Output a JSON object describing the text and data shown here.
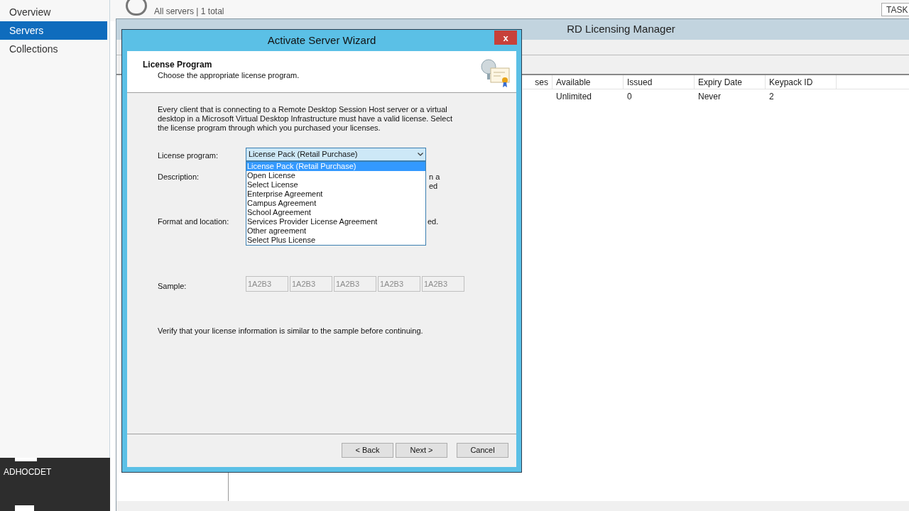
{
  "sidebar": {
    "items": [
      {
        "label": "Overview",
        "selected": false
      },
      {
        "label": "Servers",
        "selected": true
      },
      {
        "label": "Collections",
        "selected": false
      }
    ]
  },
  "taskbar": {
    "label": "ADHOCDET"
  },
  "header": {
    "subtitle": "All servers | 1 total",
    "tasks_button": "TASK"
  },
  "licensing_manager": {
    "title": "RD Licensing Manager",
    "columns": [
      "ses",
      "Available",
      "Issued",
      "Expiry Date",
      "Keypack ID"
    ],
    "rows": [
      [
        "",
        "Unlimited",
        "0",
        "Never",
        "2"
      ]
    ]
  },
  "wizard": {
    "title": "Activate Server Wizard",
    "close": "x",
    "heading": "License Program",
    "subheading": "Choose the appropriate license program.",
    "intro": "Every client that is connecting to a Remote Desktop Session Host server or a virtual desktop in a Microsoft Virtual Desktop Infrastructure must have a valid license. Select the license program through which you purchased your licenses.",
    "license_program": {
      "label": "License program:",
      "value": "License Pack (Retail Purchase)",
      "expanded": true,
      "options": [
        {
          "label": "License Pack (Retail Purchase)",
          "selected": true
        },
        {
          "label": "Open License",
          "selected": false
        },
        {
          "label": "Select License",
          "selected": false
        },
        {
          "label": "Enterprise Agreement",
          "selected": false
        },
        {
          "label": "Campus Agreement",
          "selected": false
        },
        {
          "label": "School Agreement",
          "selected": false
        },
        {
          "label": "Services Provider License Agreement",
          "selected": false
        },
        {
          "label": "Other agreement",
          "selected": false
        },
        {
          "label": "Select Plus License",
          "selected": false
        }
      ]
    },
    "description": {
      "label": "Description:",
      "visible_lines": [
        "n a",
        "ed"
      ]
    },
    "format": {
      "label": "Format and location:",
      "visible_text": "ed."
    },
    "sample": {
      "label": "Sample:",
      "values": [
        "1A2B3",
        "1A2B3",
        "1A2B3",
        "1A2B3",
        "1A2B3"
      ]
    },
    "verify": "Verify that your license information is similar to the sample before continuing.",
    "buttons": [
      "< Back",
      "Next >",
      "Cancel"
    ]
  }
}
